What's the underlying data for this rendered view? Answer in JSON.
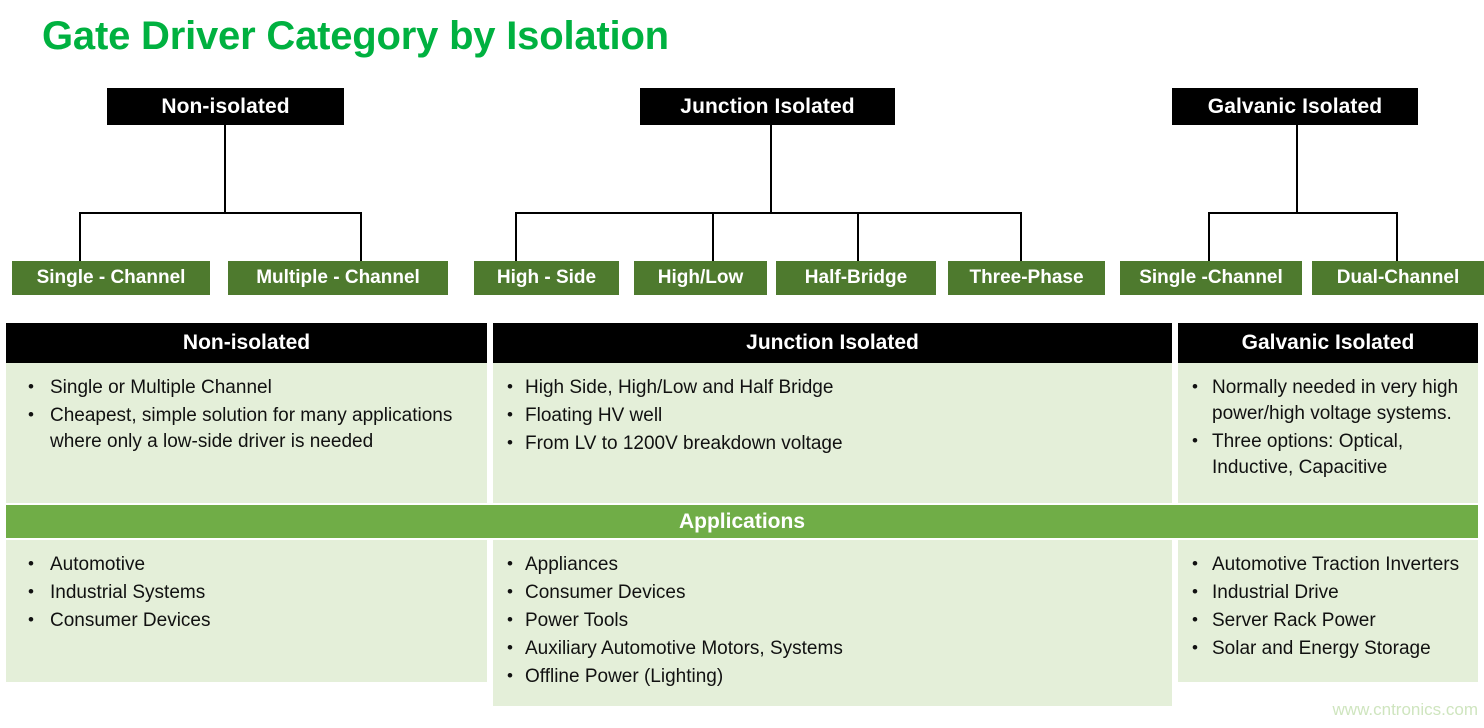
{
  "page": {
    "title": "Gate Driver Category by Isolation",
    "watermark": "www.cntronics.com",
    "colors": {
      "title_green": "#00b140",
      "leaf_green": "#4e7a2e",
      "banner_green": "#70ad47",
      "cell_green": "#e4efd9",
      "header_black": "#000000",
      "watermark_green": "#cfe5bf"
    }
  },
  "tree": {
    "categories": [
      {
        "label": "Non-isolated",
        "children": [
          {
            "label": "Single - Channel"
          },
          {
            "label": "Multiple - Channel"
          }
        ]
      },
      {
        "label": "Junction Isolated",
        "children": [
          {
            "label": "High - Side"
          },
          {
            "label": "High/Low"
          },
          {
            "label": "Half-Bridge"
          },
          {
            "label": "Three-Phase"
          }
        ]
      },
      {
        "label": "Galvanic Isolated",
        "children": [
          {
            "label": "Single -Channel"
          },
          {
            "label": "Dual-Channel"
          }
        ]
      }
    ]
  },
  "table": {
    "headers": [
      "Non-isolated",
      "Junction Isolated",
      "Galvanic Isolated"
    ],
    "features": [
      [
        "Single or Multiple Channel",
        "Cheapest, simple solution for many applications where only a low-side driver is needed"
      ],
      [
        "High Side, High/Low and Half Bridge",
        "Floating HV well",
        "From LV to 1200V breakdown voltage"
      ],
      [
        "Normally needed in very high power/high voltage systems.",
        "Three options: Optical, Inductive, Capacitive"
      ]
    ],
    "applications_label": "Applications",
    "applications": [
      [
        "Automotive",
        "Industrial Systems",
        "Consumer Devices"
      ],
      [
        "Appliances",
        "Consumer Devices",
        "Power Tools",
        "Auxiliary Automotive Motors, Systems",
        "Offline Power (Lighting)"
      ],
      [
        "Automotive Traction Inverters",
        "Industrial Drive",
        "Server Rack Power",
        "Solar and Energy Storage"
      ]
    ]
  }
}
